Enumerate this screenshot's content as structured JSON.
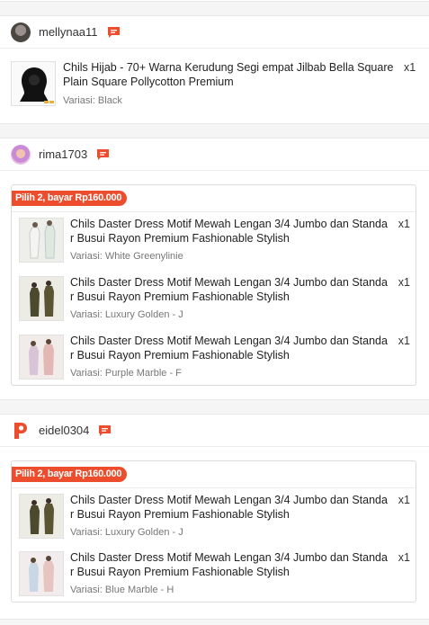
{
  "shops": [
    {
      "name": "mellynaa11",
      "products": [
        {
          "name": "Chils Hijab - 70+ Warna Kerudung Segi empat Jilbab Bella Square Plain Square Pollycotton Premium",
          "variant": "Variasi: Black",
          "qty": "x1"
        }
      ]
    },
    {
      "name": "rima1703",
      "bundle_label": "Pilih 2, bayar Rp160.000",
      "products": [
        {
          "name": "Chils Daster Dress Motif Mewah Lengan 3/4 Jumbo dan Standa r Busui Rayon Premium Fashionable Stylish",
          "variant": "Variasi: White Greenylinie",
          "qty": "x1"
        },
        {
          "name": "Chils Daster Dress Motif Mewah Lengan 3/4 Jumbo dan Standa r Busui Rayon Premium Fashionable Stylish",
          "variant": "Variasi: Luxury Golden - J",
          "qty": "x1"
        },
        {
          "name": "Chils Daster Dress Motif Mewah Lengan 3/4 Jumbo dan Standa r Busui Rayon Premium Fashionable Stylish",
          "variant": "Variasi: Purple Marble - F",
          "qty": "x1"
        }
      ]
    },
    {
      "name": "eidel0304",
      "bundle_label": "Pilih 2, bayar Rp160.000",
      "products": [
        {
          "name": "Chils Daster Dress Motif Mewah Lengan 3/4 Jumbo dan Standa r Busui Rayon Premium Fashionable Stylish",
          "variant": "Variasi: Luxury Golden - J",
          "qty": "x1"
        },
        {
          "name": "Chils Daster Dress Motif Mewah Lengan 3/4 Jumbo dan Standa r Busui Rayon Premium Fashionable Stylish",
          "variant": "Variasi: Blue Marble - H",
          "qty": "x1"
        }
      ]
    }
  ],
  "colors": {
    "accent": "#ee4d2d",
    "text": "#222222",
    "muted": "#777777",
    "background": "#f5f5f5"
  },
  "icons": {
    "chat": "chat-bubble-icon",
    "shop_logo": "p-logo-icon"
  }
}
